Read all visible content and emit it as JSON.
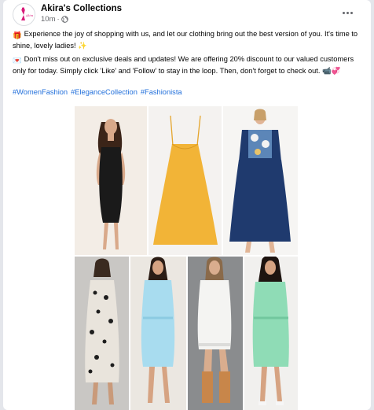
{
  "post": {
    "page_name": "Akira's Collections",
    "time": "10m",
    "dot": "·",
    "paragraph1": "Experience the joy of shopping with us, and let our clothing bring out the best version of you. It's time to shine, lovely ladies! ✨",
    "paragraph1_emoji": "🎁",
    "paragraph2": "Don't miss out on exclusive deals and updates! We are offering 20% discount to our valued customers only for today. Simply click 'Like' and 'Follow' to stay in the loop. Then, don't forget to check out. 📹💞",
    "paragraph2_emoji": "💌",
    "hashtags": [
      "#WomenFashion",
      "#EleganceCollection",
      "#Fashionista"
    ]
  },
  "icons": {
    "avatar": "akiras-collections-logo",
    "privacy": "globe-icon",
    "menu": "more-options-icon"
  },
  "colors": {
    "link": "#216fdb",
    "secondary_text": "#65676b",
    "page_bg": "#e4e6eb",
    "card_bg": "#ffffff"
  },
  "photos": [
    {
      "name": "black-satin-dress-photo",
      "background": "#f3ede6",
      "dress": "#1a1a1a"
    },
    {
      "name": "yellow-polka-dot-dress-photo",
      "background": "#f4f2f0",
      "dress": "#f2b437"
    },
    {
      "name": "navy-floral-dress-photo",
      "background": "#f6f5f3",
      "dress": "#1f3a6e"
    },
    {
      "name": "leopard-print-dress-photo",
      "background": "#c9c7c4",
      "dress": "#e9e4dc"
    },
    {
      "name": "light-blue-dress-photo",
      "background": "#ebe7e1",
      "dress": "#a8dcef"
    },
    {
      "name": "white-lace-dress-photo",
      "background": "#8a8c8e",
      "dress": "#f4f4f2"
    },
    {
      "name": "mint-green-dress-photo",
      "background": "#f1f0ee",
      "dress": "#8fdcb6"
    }
  ]
}
